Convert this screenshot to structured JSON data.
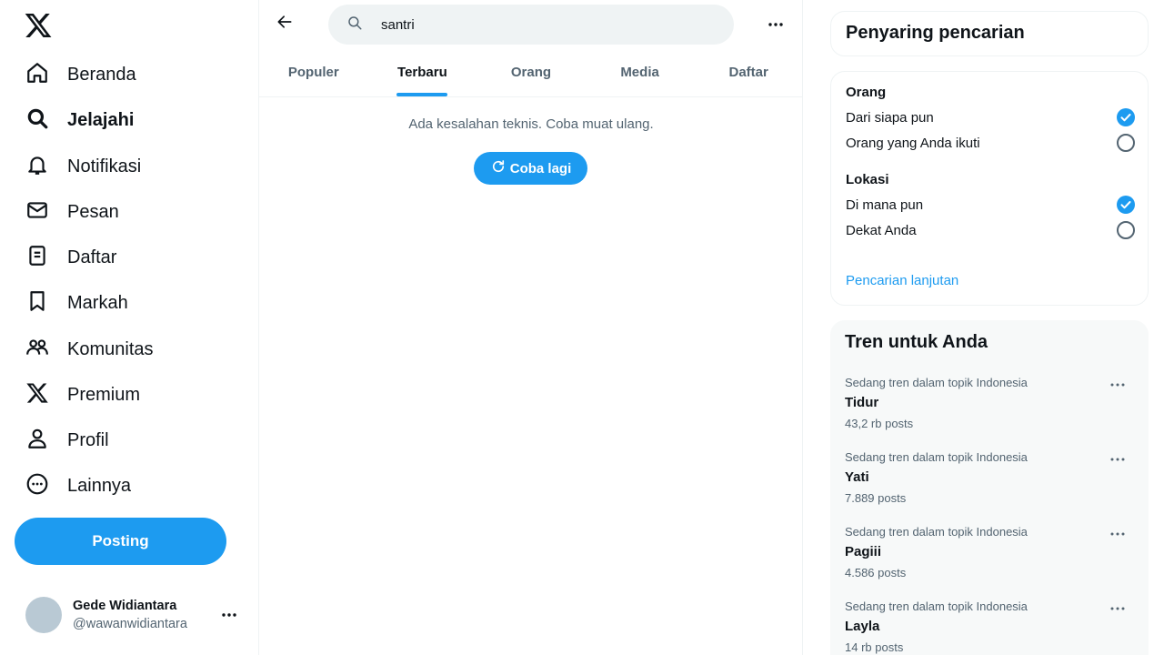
{
  "sidebar": {
    "logo": "x-logo-icon",
    "items": [
      {
        "label": "Beranda",
        "icon": "home-icon"
      },
      {
        "label": "Jelajahi",
        "icon": "search-icon"
      },
      {
        "label": "Notifikasi",
        "icon": "bell-icon"
      },
      {
        "label": "Pesan",
        "icon": "envelope-icon"
      },
      {
        "label": "Daftar",
        "icon": "list-icon"
      },
      {
        "label": "Markah",
        "icon": "bookmark-icon"
      },
      {
        "label": "Komunitas",
        "icon": "people-icon"
      },
      {
        "label": "Premium",
        "icon": "x-logo-icon"
      },
      {
        "label": "Profil",
        "icon": "person-icon"
      },
      {
        "label": "Lainnya",
        "icon": "more-circle-icon"
      }
    ],
    "active_item": "Jelajahi",
    "post_label": "Posting",
    "account": {
      "name": "Gede Widiantara",
      "handle": "@wawanwidiantara"
    }
  },
  "main": {
    "search": {
      "value": "santri"
    },
    "tabs": [
      {
        "label": "Populer"
      },
      {
        "label": "Terbaru"
      },
      {
        "label": "Orang"
      },
      {
        "label": "Media"
      },
      {
        "label": "Daftar"
      }
    ],
    "active_tab": "Terbaru",
    "error_message": "Ada kesalahan teknis. Coba muat ulang.",
    "retry_label": "Coba lagi"
  },
  "filters": {
    "title": "Penyaring pencarian",
    "people": {
      "title": "Orang",
      "options": [
        {
          "label": "Dari siapa pun",
          "checked": true
        },
        {
          "label": "Orang yang Anda ikuti",
          "checked": false
        }
      ]
    },
    "location": {
      "title": "Lokasi",
      "options": [
        {
          "label": "Di mana pun",
          "checked": true
        },
        {
          "label": "Dekat Anda",
          "checked": false
        }
      ]
    },
    "advanced_link": "Pencarian lanjutan"
  },
  "trends": {
    "title": "Tren untuk Anda",
    "items": [
      {
        "context": "Sedang tren dalam topik Indonesia",
        "name": "Tidur",
        "count": "43,2 rb posts"
      },
      {
        "context": "Sedang tren dalam topik Indonesia",
        "name": "Yati",
        "count": "7.889 posts"
      },
      {
        "context": "Sedang tren dalam topik Indonesia",
        "name": "Pagiii",
        "count": "4.586 posts"
      },
      {
        "context": "Sedang tren dalam topik Indonesia",
        "name": "Layla",
        "count": "14 rb posts"
      }
    ]
  },
  "colors": {
    "accent": "#1d9bf0",
    "text": "#0f1419",
    "secondary_text": "#536471",
    "border": "#eff3f4",
    "panel_bg": "#f7f9f9"
  }
}
